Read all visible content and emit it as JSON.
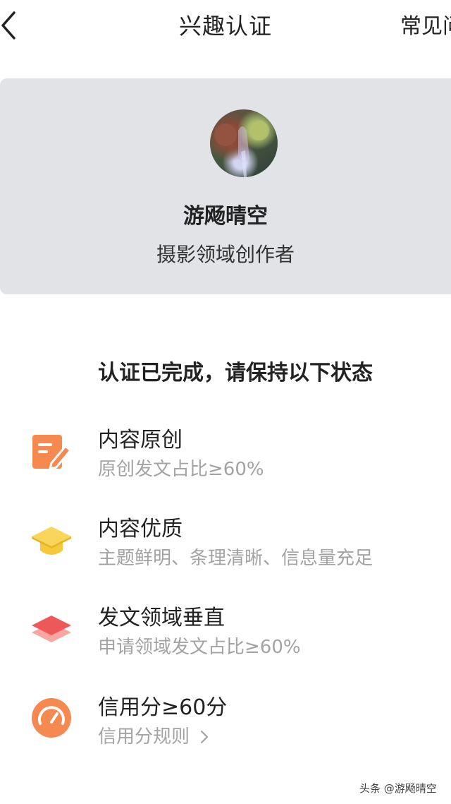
{
  "nav": {
    "title": "兴趣认证",
    "faq_label": "常见问"
  },
  "profile": {
    "nickname": "游飏晴空",
    "domain_role": "摄影领域创作者"
  },
  "status": {
    "heading": "认证已完成，请保持以下状态"
  },
  "requirements": [
    {
      "icon": "edit-document-icon",
      "title": "内容原创",
      "desc": "原创发文占比≥60%",
      "color": "#f5894f"
    },
    {
      "icon": "graduation-cap-icon",
      "title": "内容优质",
      "desc": "主题鲜明、条理清晰、信息量充足",
      "color": "#f7c83a"
    },
    {
      "icon": "layers-icon",
      "title": "发文领域垂直",
      "desc": "申请领域发文占比≥60%",
      "color": "#f0575b"
    },
    {
      "icon": "gauge-icon",
      "title": "信用分≥60分",
      "desc": "信用分规则",
      "color": "#f5894f"
    }
  ],
  "watermark": "头条 @游飏晴空"
}
